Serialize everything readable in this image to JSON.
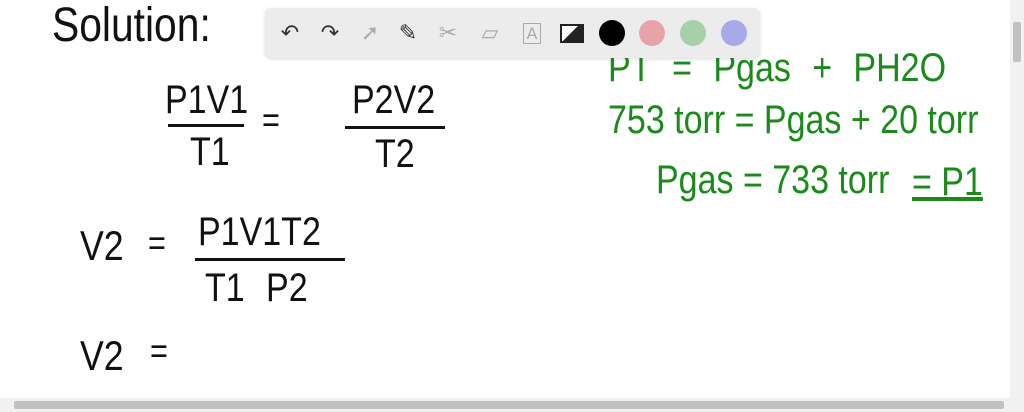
{
  "board": {
    "title": "Solution:",
    "eq1": {
      "lhs_num": "P1V1",
      "lhs_den": "T1",
      "eq": "=",
      "rhs_num": "P2V2",
      "rhs_den": "T2"
    },
    "eq2": {
      "lhs": "V2",
      "eq": "=",
      "num": "P1V1T2",
      "den": "T1 P2"
    },
    "eq3": {
      "lhs": "V2",
      "eq": "="
    },
    "green": [
      "PT = Pgas + PH2O",
      "753 torr = Pgas + 20 torr",
      "Pgas = 733 torr",
      "= P1"
    ]
  },
  "toolbar": {
    "tools": [
      "undo-icon",
      "redo-icon",
      "select-icon",
      "pen-icon",
      "tools-icon",
      "eraser-icon",
      "text-icon",
      "image-icon"
    ],
    "colors": [
      "#000000",
      "#e8a3a9",
      "#a8d0a8",
      "#a9a9e8"
    ]
  }
}
